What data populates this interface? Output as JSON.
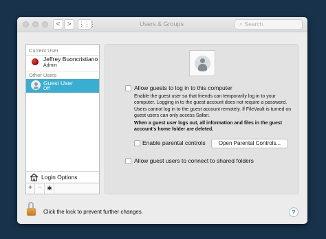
{
  "window": {
    "title": "Users & Groups",
    "search_placeholder": "Search",
    "back_glyph": "<",
    "forward_glyph": ">",
    "grid_glyph": "⋮⋮⋮"
  },
  "sidebar": {
    "current_user_header": "Current User",
    "current_user": {
      "name": "Jeffrey Buoncristiano",
      "role": "Admin",
      "icon": "red-ball-avatar-icon"
    },
    "other_users_header": "Other Users",
    "other_users": [
      {
        "name": "Guest User",
        "status": "Off",
        "selected": true,
        "icon": "guest-avatar-icon"
      }
    ],
    "login_options_label": "Login Options",
    "toolbar": {
      "add": "+",
      "remove": "−",
      "gear": "✱"
    }
  },
  "panel": {
    "allow_guests_label": "Allow guests to log in to this computer",
    "allow_guests_checked": false,
    "description": "Enable the guest user so that friends can temporarily log in to your computer. Logging in to the guest account does not require a password. Users cannot log in to the guest account remotely. If FileVault is turned on guest users can only access Safari.",
    "warning": "When a guest user logs out, all information and files in the guest account's home folder are deleted.",
    "parental_controls_label": "Enable parental controls",
    "parental_controls_checked": false,
    "open_parental_button": "Open Parental Controls...",
    "shared_folders_label": "Allow guest users to connect to shared folders",
    "shared_folders_checked": false
  },
  "footer": {
    "lock_label": "Click the lock to prevent further changes.",
    "help_glyph": "?"
  },
  "colors": {
    "selection": "#3aadd2",
    "background": "#17324a",
    "lock": "#d9913a"
  }
}
